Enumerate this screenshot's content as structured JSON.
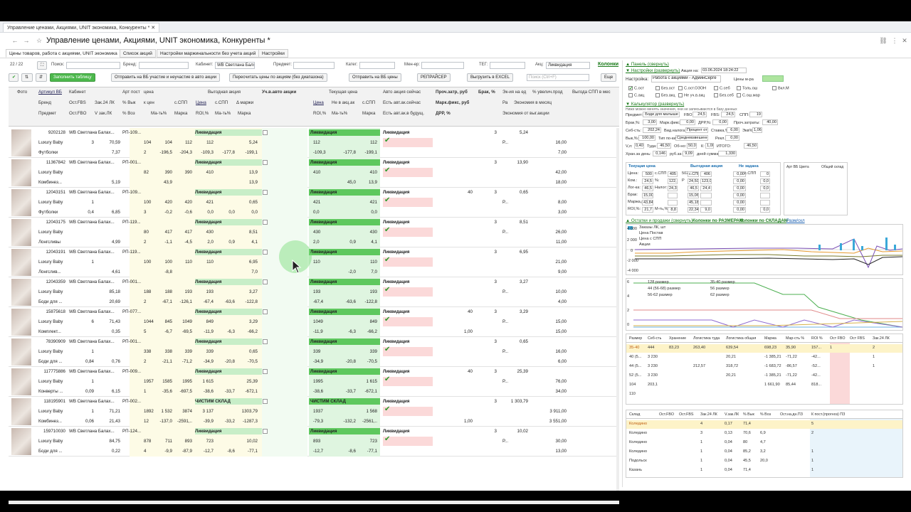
{
  "browser_tab": "Управление ценами, Акциями, UNIT экономика, Конкуренты *",
  "title": "Управление ценами, Акциями, UNIT экономика, Конкуренты *",
  "section_tabs": [
    "Цены товаров, работа с акциями, UNIT экономика",
    "Список акций",
    "Настройки маржинальности без учета акций",
    "Настройки"
  ],
  "filters": {
    "counter": "22 / 22",
    "search_label": "Поиск:",
    "brand_label": "Бренд:",
    "cabinet_label": "Кабинет:",
    "cabinet_value": "WB Светлана Балх",
    "subject_label": "Предмет:",
    "category_label": "Катег:",
    "manager_label": "Мен-ер:",
    "tag_label": "ТЕГ:",
    "promo_label": "Акц:",
    "promo_value": "Ликвидация",
    "columns_link": "Колонки",
    "search_placeholder": "Поиск (Ctrl+F)"
  },
  "toolbar": {
    "fill": "Заполнить таблицу",
    "send_wb": "Отправить на ВБ участие и неучастие в авто акции",
    "recalc": "Пересчитать цены по акциям (без диапазона)",
    "send_prices": "Отправить на ВБ цены",
    "repricer": "РЕПРАЙСЕР",
    "excel": "Выгрузить в EXCEL",
    "more": "Еще"
  },
  "headers": {
    "r1": [
      "Фото",
      "Артикул ВБ",
      "Кабинет",
      "Арт пост",
      "цена",
      "Выгодная акция",
      "Уч.в.авто акции",
      "Текущая цена",
      "Авто акция сейчас",
      "Проч.затр, руб",
      "Брак, %",
      "Эк-ия на ед",
      "% увелич.прод",
      "Выгода СПП в мес"
    ],
    "r2": [
      "Бренд",
      "Ост.FBS",
      "Зак.24 ЛК",
      "% Вык",
      "к цен",
      "с.СПП",
      "Цена",
      "с.СПП",
      "Δ маржи",
      "Цена",
      "Не в акц.ак",
      "с.СПП",
      "Есть авт.ак.сейчас",
      "Марк.фикс, руб",
      "Ра",
      "Экономия в месяц"
    ],
    "r3": [
      "Предмет",
      "Ост.FBO",
      "V зак.ЛК",
      "% Воз",
      "Ма-ть%",
      "Марка",
      "ROI,%",
      "Ма-ть%",
      "Марка",
      "ROI,%",
      "Ма-ть%",
      "Марка",
      "Есть авт.ак.в будущ.",
      "ДРР, %",
      "Экономия от выг.акции"
    ]
  },
  "rows": [
    {
      "art": "9202128",
      "cab": "WB Светлана Балах...",
      "post": "РП-109...",
      "brand": "Luxury Baby",
      "subj": "Футболки",
      "fbs": "3",
      "zak": "70,59",
      "vyk": "104",
      "fbo": "",
      "vzak": "7,37",
      "voz": "2",
      "a1": "104",
      "a2": "112",
      "a3": "112",
      "a4": "5,24",
      "b1": "-196,5",
      "b2": "-204,3",
      "b3": "-109,3",
      "b4": "-177,8",
      "b5": "-199,1",
      "promo": "Ликвидация",
      "cp": "112",
      "cp2": "112",
      "cr1": "-109,3",
      "cr2": "-177,8",
      "cr3": "-199,1",
      "auto": "Ликвидация",
      "proch": "",
      "brak": "3",
      "ek": "5,24",
      "p": "Р...",
      "uv": "16,00",
      "ec": "7,00"
    },
    {
      "art": "11367842",
      "cab": "WB Светлана Балах...",
      "post": "РП-001...",
      "brand": "Luxury Baby",
      "subj": "Комбинез...",
      "fbs": "",
      "zak": "",
      "vyk": "82",
      "fbo": "",
      "vzak": "5,19",
      "voz": "",
      "a1": "390",
      "a2": "390",
      "a3": "410",
      "a4": "13,9",
      "b1": "43,9",
      "b2": "",
      "b3": "",
      "b4": "",
      "b5": "13,9",
      "promo": "Ликвидация",
      "cp": "410",
      "cp2": "410",
      "cr1": "",
      "cr2": "45,0",
      "cr3": "13,9",
      "auto": "Ликвидация",
      "proch": "",
      "brak": "3",
      "ek": "13,90",
      "p": "",
      "uv": "42,00",
      "ec": "18,00"
    },
    {
      "art": "12043151",
      "cab": "WB Светлана Балах...",
      "post": "РП-109...",
      "brand": "Luxury Baby",
      "subj": "Футболки",
      "fbs": "1",
      "zak": "",
      "vyk": "100",
      "fbo": "0,4",
      "vzak": "6,85",
      "voz": "3",
      "a1": "420",
      "a2": "420",
      "a3": "421",
      "a4": "0,65",
      "b1": "-0,2",
      "b2": "-0,6",
      "b3": "0,0",
      "b4": "0,0",
      "b5": "0,0",
      "promo": "Ликвидация",
      "cp": "421",
      "cp2": "421",
      "cr1": "0,0",
      "cr2": "",
      "cr3": "0,0",
      "auto": "Ликвидация",
      "proch": "40",
      "brak": "3",
      "ek": "0,65",
      "p": "Р...",
      "uv": "8,00",
      "ec": "3,00"
    },
    {
      "art": "12043175",
      "cab": "WB Светлана Балах...",
      "post": "РП-119...",
      "brand": "Luxury Baby",
      "subj": "Лонгсливы",
      "fbs": "",
      "zak": "",
      "vyk": "80",
      "fbo": "",
      "vzak": "4,99",
      "voz": "2",
      "a1": "417",
      "a2": "417",
      "a3": "430",
      "a4": "8,51",
      "b1": "-1,1",
      "b2": "-4,5",
      "b3": "2,0",
      "b4": "0,9",
      "b5": "4,1",
      "promo": "Ликвидация",
      "cp": "430",
      "cp2": "430",
      "cr1": "2,0",
      "cr2": "0,9",
      "cr3": "4,1",
      "auto": "Ликвидация",
      "proch": "",
      "brak": "3",
      "ek": "8,51",
      "p": "Р...",
      "uv": "26,00",
      "ec": "11,00"
    },
    {
      "art": "12043191",
      "cab": "WB Светлана Балах...",
      "post": "РП-119...",
      "brand": "Luxury Baby",
      "subj": "Лонгслив...",
      "fbs": "1",
      "zak": "",
      "vyk": "100",
      "fbo": "",
      "vzak": "4,61",
      "voz": "",
      "a1": "100",
      "a2": "110",
      "a3": "110",
      "a4": "6,95",
      "b1": "-8,8",
      "b2": "",
      "b3": "",
      "b4": "",
      "b5": "7,0",
      "promo": "Ликвидация",
      "cp": "110",
      "cp2": "110",
      "cr1": "",
      "cr2": "-2,0",
      "cr3": "7,0",
      "auto": "Ликвидация",
      "proch": "",
      "brak": "3",
      "ek": "6,95",
      "p": "",
      "uv": "21,00",
      "ec": "9,00"
    },
    {
      "art": "12043359",
      "cab": "WB Светлана Балах...",
      "post": "РП-001...",
      "brand": "Luxury Baby",
      "subj": "Боди для ...",
      "fbs": "",
      "zak": "85,18",
      "vyk": "188",
      "fbo": "",
      "vzak": "20,69",
      "voz": "2",
      "a1": "188",
      "a2": "193",
      "a3": "193",
      "a4": "3,27",
      "b1": "-67,1",
      "b2": "-126,1",
      "b3": "-67,4",
      "b4": "-63,6",
      "b5": "-122,8",
      "promo": "Ликвидация",
      "cp": "193",
      "cp2": "193",
      "cr1": "-67,4",
      "cr2": "-63,6",
      "cr3": "-122,8",
      "auto": "Ликвидация",
      "proch": "",
      "brak": "3",
      "ek": "3,27",
      "p": "Р...",
      "uv": "10,00",
      "ec": "4,00"
    },
    {
      "art": "15875618",
      "cab": "WB Светлана Балах...",
      "post": "РП-077...",
      "brand": "Luxury Baby",
      "subj": "Комплект...",
      "fbs": "6",
      "zak": "71,43",
      "vyk": "1044",
      "fbo": "",
      "vzak": "0,35",
      "voz": "5",
      "a1": "845",
      "a2": "1049",
      "a3": "849",
      "a4": "3,29",
      "b1": "-6,7",
      "b2": "-69,5",
      "b3": "-11,9",
      "b4": "-6,3",
      "b5": "-66,2",
      "promo": "Ликвидация",
      "cp": "1049",
      "cp2": "849",
      "cr1": "-11,9",
      "cr2": "-6,3",
      "cr3": "-66,2",
      "auto": "Ликвидация",
      "proch": "40",
      "brak": "3",
      "ek": "3,29",
      "p": "Р...",
      "uv": "15,00",
      "ec": "15,00",
      "drr": "1,00"
    },
    {
      "art": "78390909",
      "cab": "WB Светлана Балах...",
      "post": "РП-001...",
      "brand": "Luxury Baby",
      "subj": "Боди для ...",
      "fbs": "1",
      "zak": "",
      "vyk": "338",
      "fbo": "0,84",
      "vzak": "0,76",
      "voz": "2",
      "a1": "338",
      "a2": "339",
      "a3": "339",
      "a4": "0,65",
      "b1": "-21,1",
      "b2": "-71,2",
      "b3": "-34,9",
      "b4": "-20,8",
      "b5": "-70,5",
      "promo": "Ликвидация",
      "cp": "339",
      "cp2": "339",
      "cr1": "-34,9",
      "cr2": "-20,8",
      "cr3": "-70,5",
      "auto": "Ликвидация",
      "proch": "",
      "brak": "3",
      "ek": "0,65",
      "p": "Р...",
      "uv": "16,00",
      "ec": "6,00"
    },
    {
      "art": "117775886",
      "cab": "WB Светлана Балах...",
      "post": "РП-009...",
      "brand": "Luxury Baby",
      "subj": "Конверты ...",
      "fbs": "1",
      "zak": "",
      "vyk": "1957",
      "fbo": "0,09",
      "vzak": "6,15",
      "voz": "1",
      "a1": "1585",
      "a2": "1995",
      "a3": "1 615",
      "a4": "25,39",
      "b1": "-35,6",
      "b2": "-697,5",
      "b3": "-38,6",
      "b4": "-33,7",
      "b5": "-672,1",
      "promo": "Ликвидация",
      "cp": "1995",
      "cp2": "1 615",
      "cr1": "-38,6",
      "cr2": "-33,7",
      "cr3": "-672,1",
      "auto": "Ликвидация",
      "proch": "40",
      "brak": "3",
      "ek": "25,39",
      "p": "Р...",
      "uv": "76,00",
      "ec": "34,00"
    },
    {
      "art": "118195901",
      "cab": "WB Светлана Балах...",
      "post": "РП-002...",
      "brand": "Luxury Baby",
      "subj": "Комбинез...",
      "fbs": "1",
      "zak": "71,21",
      "vyk": "1892",
      "fbo": "0,06",
      "vzak": "21,43",
      "voz": "12",
      "a1": "1 532",
      "a2": "3874",
      "a3": "3 137",
      "a4": "1303,79",
      "b1": "-137,0",
      "b2": "-2591,..",
      "b3": "-39,9",
      "b4": "-33,2",
      "b5": "-1287,3",
      "promo": "ЧИСТИМ СКЛАД",
      "cp": "1937",
      "cp2": "1 568",
      "cr1": "-79,3",
      "cr2": "-132,2",
      "cr3": "-2561,..",
      "auto": "Ликвидация",
      "proch": "",
      "brak": "3",
      "ek": "1 303,79",
      "p": "",
      "uv": "3 911,00",
      "ec": "3 551,00",
      "drr": "1,00"
    },
    {
      "art": "159710030",
      "cab": "WB Светлана Балах...",
      "post": "РП-124...",
      "brand": "Luxury Baby",
      "subj": "Боди для ...",
      "fbs": "",
      "zak": "84,75",
      "vyk": "878",
      "fbo": "",
      "vzak": "0,22",
      "voz": "4",
      "a1": "711",
      "a2": "893",
      "a3": "723",
      "a4": "10,02",
      "b1": "-9,9",
      "b2": "-87,9",
      "b3": "-12,7",
      "b4": "-8,6",
      "b5": "-77,1",
      "promo": "Ликвидация",
      "cp": "893",
      "cp2": "723",
      "cr1": "-12,7",
      "cr2": "-8,6",
      "cr3": "-77,1",
      "auto": "Ликвидация",
      "proch": "",
      "brak": "3",
      "ek": "10,02",
      "p": "Р...",
      "uv": "30,00",
      "ec": "13,00"
    }
  ],
  "right": {
    "panel_link": "▲ Панель (свернуть)",
    "settings_link": "▼ Настройки (развернуть)",
    "promo_on": "Акция на:",
    "promo_date": "03.06.2024 18:24:22",
    "setting_label": "Настройка:",
    "setting_value": "Работа с акциями - АдминСерге",
    "prices_mr": "Цены м-ра",
    "checks": [
      "С.ост",
      "Без.ост",
      "С.ост.ОЗОН",
      "С.себ",
      "Толь.ош",
      "Вкл.М",
      "С.акц",
      "Без.акц",
      "Не уч.в.акц",
      "Без.себ",
      "С.ош.мар"
    ],
    "calc_link": "▼ Калькулятор (развернуть)",
    "calc_note": "Ниже можно менять значения, они не записываются в базу данных",
    "calc": {
      "subject": "Предмет:",
      "subject_v": "Боди для малыше",
      "fbo": "FBO:",
      "fbo_v": "24,5",
      "fbs": "FBS:",
      "fbs_v": "24,5",
      "spp": "СПП:",
      "spp_v": "19",
      "brak": "Брак,%:",
      "brak_v": "3,00",
      "mark": "Марк.фикс:",
      "mark_v": "0,00",
      "drr": "ДРР,%:",
      "drr_v": "0,00",
      "proch": "Проч.затраты:",
      "proch_v": "40,00",
      "seb": "Себ-сть:",
      "seb_v": "202,24",
      "tax": "Вид.налога:",
      "tax_v": "Процент от",
      "rate": "Ставка,%:",
      "rate_v": "6,00",
      "ekv": "Экв%:",
      "ekv_v": "1,06",
      "vyk": "Вык,%:",
      "vyk_v": "100,00",
      "tip": "Тип по-ки:",
      "tip_v": "Средневзвешенн",
      "rekl": "Рекл.:",
      "rekl_v": "0,00",
      "vl": "V,л:",
      "vl_v": "0,40",
      "tuda": "Туда:",
      "tuda_v": "46,50",
      "obr": "Об-но:",
      "obr_v": "50,0",
      "k": "К:",
      "k_v": "1,00",
      "itogo": "ИТОГО:",
      "itogo_v": "46,50",
      "hran": "Хран.за день:",
      "hran_v": "0,146",
      "hran_unit": "руб.за:",
      "hran_days": "9,09",
      "hran_sum_l": "дней сумма:",
      "hran_sum": "1,330"
    },
    "cur_price": "Текущая цена",
    "best_promo": "Выгодная акция",
    "not_set": "Не задана",
    "calc_rows": [
      [
        "Цена:",
        "500",
        "с.СПП",
        "405",
        "502",
        "с.СПП",
        "406",
        "",
        "0,00",
        "с.СПП",
        "0"
      ],
      [
        "Ком.:",
        "24,5",
        "%:",
        "122,5",
        "Р",
        "24,50",
        "123,0",
        "",
        "0,00",
        "",
        "0,0"
      ],
      [
        "Лог-ка:",
        "46,5",
        "Налог:",
        "24,3",
        "",
        "46,5",
        "24,4",
        "",
        "0,00",
        "",
        "0,0"
      ],
      [
        "Брак:",
        "15,00",
        "",
        "",
        "",
        "15,06",
        "",
        "",
        "0,00",
        "",
        ""
      ],
      [
        "Маржа,руб:",
        "43,84",
        "",
        "",
        "",
        "45,18",
        "",
        "",
        "0,00",
        "",
        ""
      ],
      [
        "ROI,%:",
        "21,7",
        "М-ть,%:",
        "8,8",
        "",
        "22,34",
        "9,0",
        "",
        "0,00",
        "",
        "0,0"
      ]
    ],
    "art_wb_tsveta": "Арт ВБ Цвета",
    "total_stock": "Общий склад",
    "stock_link": "▲ Остатки и продажи (свернуть)",
    "by_size": "Колонки по РАЗМЕРАМ",
    "by_wh": "Колонки по СКЛАДАМ",
    "razm": "Разм/скл",
    "chart1": {
      "legend": [
        "Заказы ЛК, шт",
        "Цена Постав",
        "Цена с СПП",
        "Акции"
      ],
      "yticks": [
        "4 000",
        "2 000",
        "0",
        "-2 000",
        "-4 000"
      ]
    },
    "chart2": {
      "legend": [
        "128 размер",
        "35-40 размер",
        "44 (56-68) размер",
        "56 размер",
        "56-62 размер",
        "62 размер"
      ],
      "yticks": [
        "6",
        "4",
        "2",
        "0"
      ]
    },
    "sizes_head": [
      "Размер",
      "Себ-сть",
      "Хранение",
      "Логистика туда",
      "Логистика общая",
      "Маржа",
      "Мар-сть %",
      "ROI %",
      "Ост FBO",
      "Ост FBS",
      "Зак.24 ЛК"
    ],
    "sizes": [
      [
        "35-40",
        "444",
        "83,23",
        "263,40",
        "639,54",
        "698,23",
        "35,90",
        "157...",
        "1",
        "",
        "2"
      ],
      [
        "40 (5...",
        "3 230",
        "",
        "",
        "20,21",
        "-1 385,21",
        "-71,22",
        "-42...",
        "",
        "",
        "1"
      ],
      [
        "44 (5...",
        "3 230",
        "",
        "212,57",
        "318,72",
        "-1 683,72",
        "-86,57",
        "-52...",
        "",
        "",
        "1"
      ],
      [
        "52 (5...",
        "3 230",
        "",
        "",
        "20,21",
        "-1 385,21",
        "-71,22",
        "-42...",
        "",
        "",
        ""
      ],
      [
        "104",
        "203,1",
        "",
        "",
        "",
        "1 661,90",
        "85,44",
        "818...",
        "",
        "",
        ""
      ],
      [
        "110",
        "",
        "",
        "",
        "",
        "",
        "",
        "",
        "",
        "",
        ""
      ]
    ],
    "wh_head": [
      "Склад",
      "Ост.FBO",
      "Ост.FBS",
      "Зак.24 ЛК",
      "V.зак.ЛК",
      "% Вык",
      "% Воз",
      "Ост.на.дн.ПЗ",
      "К пост.(прогноз) ПЗ"
    ],
    "wh": [
      [
        "Коледино",
        "",
        "",
        "4",
        "0,17",
        "71,4",
        "",
        "",
        "5"
      ],
      [
        "Коледино",
        "",
        "",
        "3",
        "0,13",
        "70,6",
        "6,9",
        "",
        "2"
      ],
      [
        "Коледино",
        "",
        "",
        "1",
        "0,04",
        "80",
        "4,7",
        "",
        ""
      ],
      [
        "Коледино",
        "",
        "",
        "1",
        "0,04",
        "85,2",
        "3,2",
        "",
        "1"
      ],
      [
        "Подольск",
        "",
        "",
        "1",
        "0,04",
        "45,5",
        "20,0",
        "",
        "1"
      ],
      [
        "Казань",
        "",
        "",
        "1",
        "0,04",
        "71,4",
        "",
        "",
        "1"
      ]
    ]
  },
  "colors": {
    "accent_green": "#4cb84c",
    "band_green": "#dff5e0",
    "band_yellow": "#fdfbe6",
    "pink": "#fbd9d9",
    "link_green": "#1a7a1a"
  }
}
